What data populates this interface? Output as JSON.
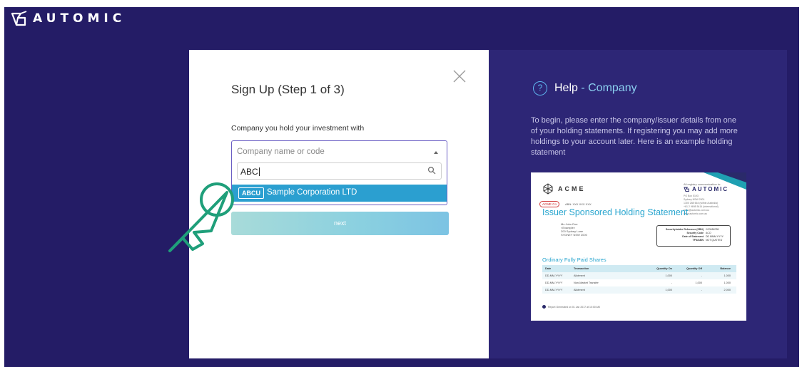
{
  "brand": {
    "name": "AUTOMIC"
  },
  "signup": {
    "title": "Sign Up (Step 1 of 3)",
    "company_label": "Company you hold your investment with",
    "company_placeholder": "Company name or code",
    "search_value": "ABC",
    "option": {
      "code": "ABCU",
      "name": "Sample Corporation LTD"
    },
    "next_label": "next"
  },
  "help": {
    "title_prefix": "Help",
    "title_suffix": " - Company",
    "text": "To begin, please enter the company/issuer details from one of your holding statements. If registering you may add more holdings to your account later. Here is an example holding statement",
    "statement": {
      "issuer": "ACME",
      "correspondence_label": "All registry communication to:",
      "correspondence_brand": "AUTOMIC",
      "correspondence_lines": [
        "PO Box 5193",
        "Sydney NSW 2001",
        "1300 288 664 (within Australia)",
        "+61 2 9698 5414 (international)",
        "hello@automic.com.au",
        "www.automic.com.au"
      ],
      "badge": "ACME Co",
      "abn": "ABN: XXX XXX XXX",
      "heading": "Issuer Sponsored Holding Statement",
      "address": [
        "Ms John Doe",
        "<Example>",
        "200 Sydney Lane",
        "SYDNEY NSW 2000"
      ],
      "refs": [
        {
          "k": "Securityholder Reference (SRN)",
          "v": "I123456789"
        },
        {
          "k": "Security Code",
          "v": "ACO"
        },
        {
          "k": "Date of Statement",
          "v": "DD MMM YYYY"
        },
        {
          "k": "TFN/ABN",
          "v": "NOT QUOTED"
        }
      ],
      "section": "Ordinary Fully Paid Shares",
      "columns": [
        "Date",
        "Transaction",
        "Quantity On",
        "Quantity Off",
        "Balance"
      ],
      "rows": [
        [
          "DD-MM-YYYY",
          "Allotment",
          "1,000",
          "-",
          "1,000"
        ],
        [
          "DD-MM-YYYY",
          "Non-Market Transfer",
          "-",
          "1,000",
          "1,000"
        ],
        [
          "DD-MM-YYYY",
          "Allotment",
          "1,000",
          "-",
          "2,000"
        ]
      ],
      "footer": "Report Generated on 01 Jan 2017 at 10:00 AM"
    }
  },
  "colors": {
    "background": "#241c66",
    "help_panel": "#2d2676",
    "accent": "#2b9fd0",
    "cursor": "#1f9f7a"
  },
  "icons": [
    "logo-icon",
    "close-icon",
    "caret-up-icon",
    "search-icon",
    "help-circle-icon",
    "pointer-cursor-icon",
    "acme-logo-icon"
  ]
}
